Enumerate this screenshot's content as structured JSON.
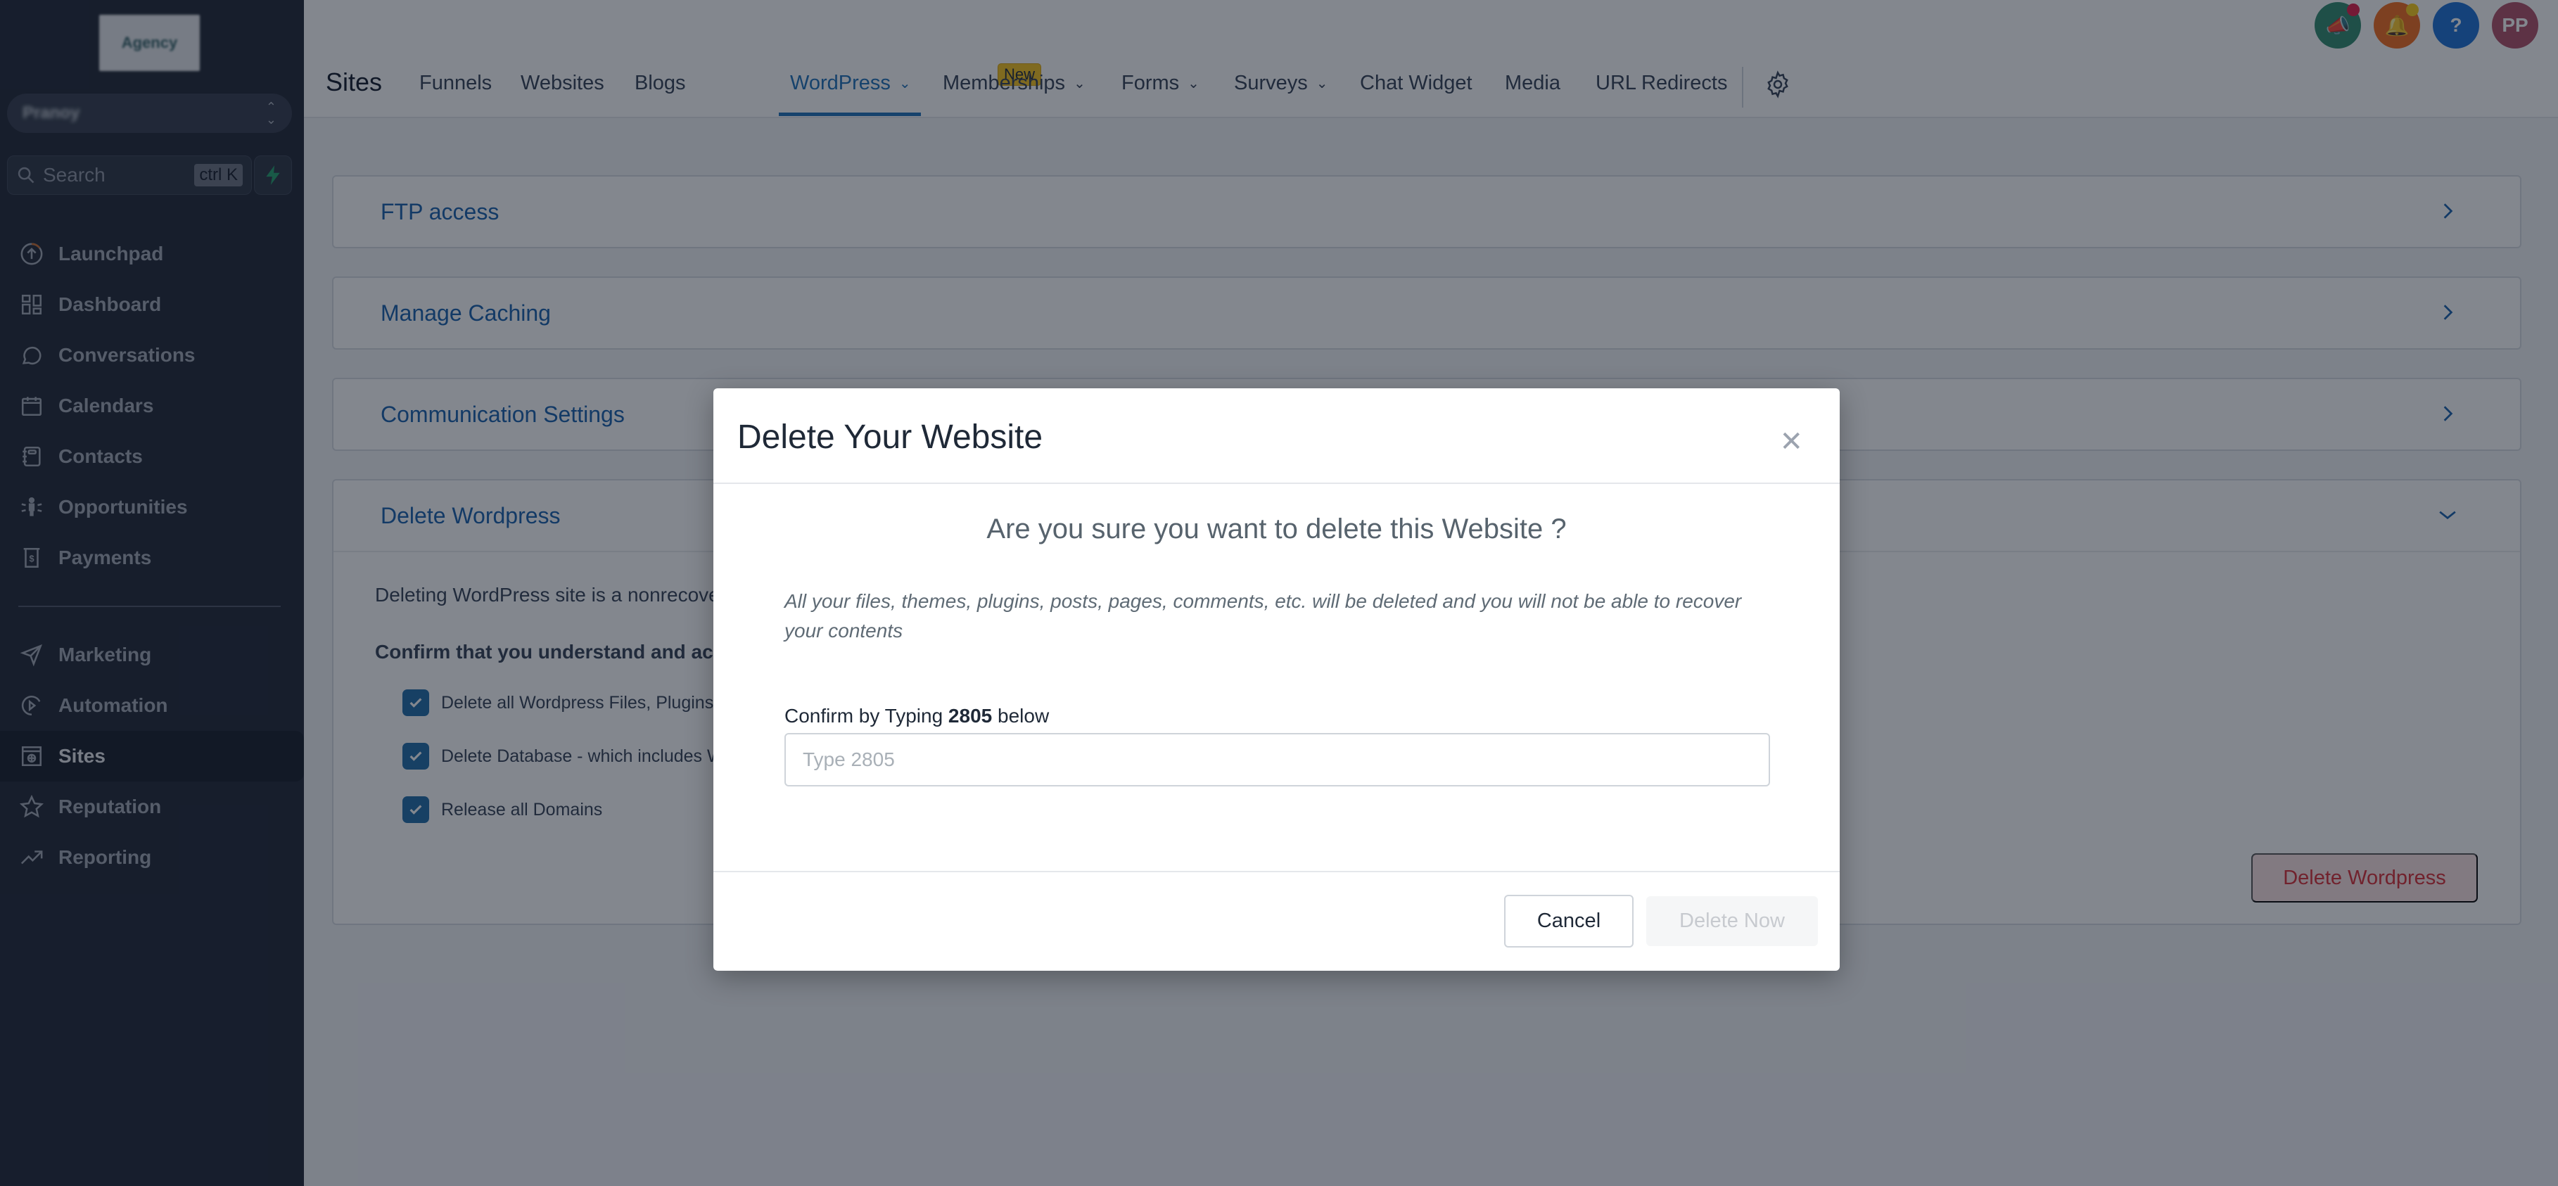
{
  "sidebar": {
    "logo_text": "Agency",
    "account_name": "Pranoy",
    "search": {
      "placeholder": "Search",
      "shortcut": "ctrl K"
    },
    "items": [
      {
        "label": "Launchpad",
        "icon": "launchpad-icon"
      },
      {
        "label": "Dashboard",
        "icon": "dashboard-icon"
      },
      {
        "label": "Conversations",
        "icon": "chat-bubble-icon"
      },
      {
        "label": "Calendars",
        "icon": "calendar-icon"
      },
      {
        "label": "Contacts",
        "icon": "contacts-book-icon"
      },
      {
        "label": "Opportunities",
        "icon": "opportunities-icon"
      },
      {
        "label": "Payments",
        "icon": "payments-icon"
      },
      {
        "label": "Marketing",
        "icon": "send-icon"
      },
      {
        "label": "Automation",
        "icon": "automation-icon"
      },
      {
        "label": "Sites",
        "icon": "sites-globe-icon",
        "active": true
      },
      {
        "label": "Reputation",
        "icon": "star-icon"
      },
      {
        "label": "Reporting",
        "icon": "trend-icon"
      }
    ]
  },
  "header": {
    "title": "Sites",
    "tabs": [
      {
        "label": "Funnels"
      },
      {
        "label": "Websites"
      },
      {
        "label": "Blogs",
        "badge": "New"
      },
      {
        "label": "WordPress",
        "dropdown": true,
        "active": true
      },
      {
        "label": "Memberships",
        "dropdown": true
      },
      {
        "label": "Forms",
        "dropdown": true
      },
      {
        "label": "Surveys",
        "dropdown": true
      },
      {
        "label": "Chat Widget"
      },
      {
        "label": "Media"
      },
      {
        "label": "URL Redirects"
      }
    ],
    "top_icons": [
      {
        "name": "announcement-icon",
        "color": "#2e8b6e",
        "dot": "#e11d48"
      },
      {
        "name": "notification-bell-icon",
        "color": "#f26b1d",
        "dot": "#facc15"
      },
      {
        "name": "help-icon",
        "label": "?",
        "color": "#1b6fd6"
      },
      {
        "name": "user-avatar",
        "label": "PP",
        "color": "#b04f68"
      }
    ]
  },
  "sections": [
    {
      "title": "FTP access",
      "expanded": false
    },
    {
      "title": "Manage Caching",
      "expanded": false
    },
    {
      "title": "Communication Settings",
      "expanded": false
    },
    {
      "title": "Delete Wordpress",
      "expanded": true,
      "description": "Deleting WordPress site is a nonrecove",
      "confirm_heading": "Confirm that you understand and ac",
      "checkboxes": [
        {
          "label": "Delete all Wordpress Files, Plugins, T",
          "checked": true
        },
        {
          "label": "Delete Database - which includes W",
          "checked": true
        },
        {
          "label": "Release all Domains",
          "checked": true
        }
      ],
      "button_label": "Delete Wordpress"
    }
  ],
  "modal": {
    "title": "Delete Your Website",
    "question": "Are you sure you want to delete this Website ?",
    "warning": "All your files, themes, plugins, posts, pages, comments, etc. will be deleted and you will not be able to recover your contents",
    "confirm_prefix": "Confirm by Typing",
    "confirm_code": "2805",
    "confirm_suffix": "below",
    "input_placeholder": "Type 2805",
    "input_value": "",
    "cancel_label": "Cancel",
    "delete_label": "Delete Now",
    "delete_enabled": false
  },
  "colors": {
    "accent": "#1d6fb8",
    "danger": "#d92d36",
    "sidebar_bg": "#1e2533"
  }
}
